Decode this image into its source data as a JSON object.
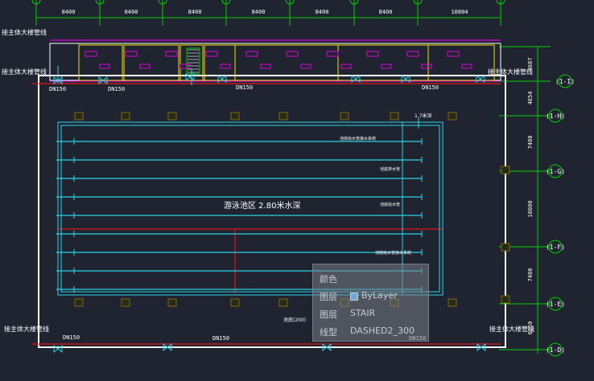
{
  "grid": {
    "spacings_top": [
      "8400",
      "8400",
      "8400",
      "8400",
      "8400",
      "8400",
      "10804"
    ],
    "spacings_right": [
      "4687",
      "4654",
      "7400",
      "10000",
      "7400",
      "6150"
    ],
    "axis_tags": [
      "(1-I)",
      "(1-H)",
      "(1-G)",
      "(1-F)",
      "(1-E)",
      "(1-D)"
    ]
  },
  "labels": {
    "main_pipe": "接主体大楼管线",
    "dn150": "DN150",
    "pool": "游泳池区 2.80米水深",
    "pool_note": "池底(200)",
    "lane_annotations": [
      "池底给水管接水系统",
      "池底排水管",
      "池底给水管",
      "池底给水管接水系统"
    ],
    "small_note": "1.7米深"
  },
  "colors": {
    "background": "#1f2430",
    "wall": "#ffffff",
    "green": "#00d000",
    "magenta": "#e000e0",
    "cyan": "#28d4e8",
    "red": "#e01818",
    "yellow": "#f0e000"
  },
  "tooltip": {
    "rows": [
      {
        "key": "颜色",
        "value": ""
      },
      {
        "key": "图层",
        "value": "ByLayer"
      },
      {
        "key": "图层",
        "value": "STAIR"
      },
      {
        "key": "线型",
        "value": "DASHED2_300"
      }
    ]
  }
}
